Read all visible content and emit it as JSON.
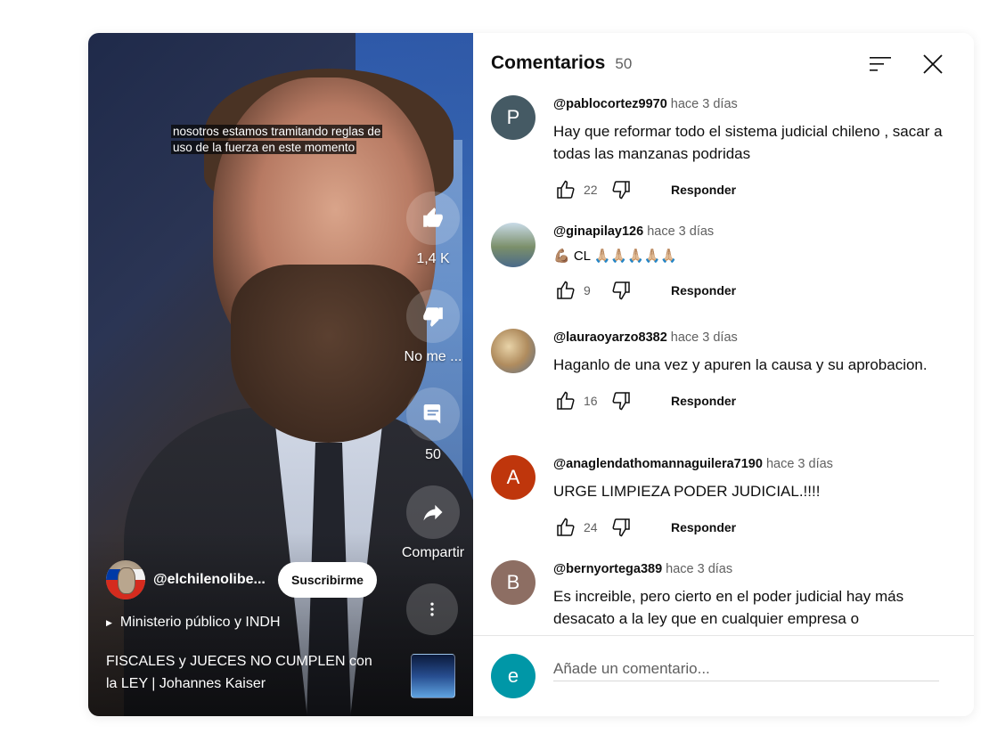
{
  "video": {
    "caption": "nosotros estamos tramitando reglas de uso de la fuerza en este momento",
    "like_count": "1,4 K",
    "dislike_label": "No me ...",
    "comment_count": "50",
    "share_label": "Compartir",
    "channel_name": "@elchilenolibe...",
    "subscribe_label": "Suscribirme",
    "music_label": "Ministerio público y INDH",
    "title": "FISCALES y JUECES NO CUMPLEN con la LEY | Johannes Kaiser"
  },
  "comments_panel": {
    "title": "Comentarios",
    "count": "50",
    "items": [
      {
        "avatar_letter": "P",
        "avatar_color": "#455a64",
        "user": "@pablocortez9970",
        "time": "hace 3 días",
        "text": "Hay que reformar todo el sistema judicial chileno , sacar a todas las manzanas podridas",
        "likes": "22",
        "reply": "Responder"
      },
      {
        "avatar_letter": "",
        "avatar_color": "#6d8a9c",
        "user": "@ginapilay126",
        "time": "hace 3 días",
        "text": "💪🏽 CL 🙏🏼🙏🏼🙏🏼🙏🏼🙏🏼",
        "likes": "9",
        "reply": "Responder"
      },
      {
        "avatar_letter": "",
        "avatar_color": "#a58d6b",
        "user": "@lauraoyarzo8382",
        "time": "hace 3 días",
        "text": "Haganlo de una vez  y apuren la causa y su aprobacion.",
        "likes": "16",
        "reply": "Responder"
      },
      {
        "avatar_letter": "A",
        "avatar_color": "#bf360c",
        "user": "@anaglendathomannaguilera7190",
        "time": "hace 3 días",
        "text": "URGE LIMPIEZA PODER JUDICIAL.!!!!",
        "likes": "24",
        "reply": "Responder"
      },
      {
        "avatar_letter": "B",
        "avatar_color": "#8d6e63",
        "user": "@bernyortega389",
        "time": "hace 3 días",
        "text": "Es increible, pero cierto en el poder judicial hay más desacato a la ley que en cualquier empresa o"
      }
    ],
    "add_comment": {
      "avatar_letter": "e",
      "placeholder": "Añade un comentario..."
    }
  }
}
